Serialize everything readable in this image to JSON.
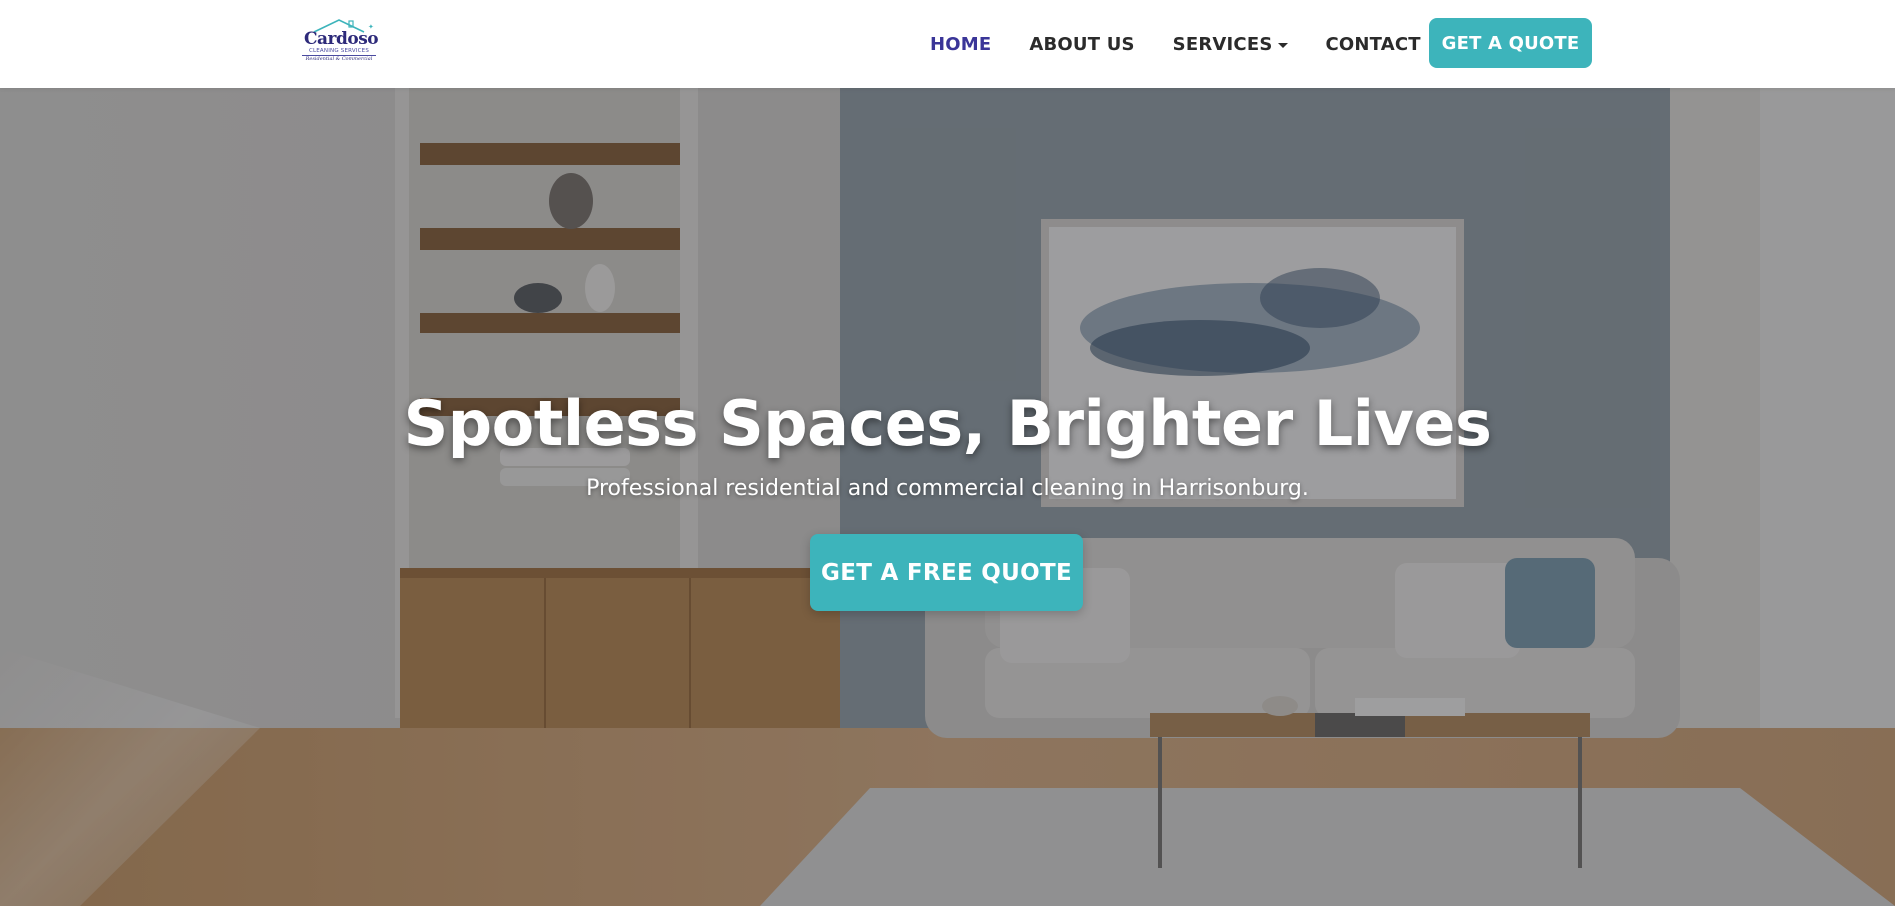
{
  "brand": {
    "name": "Cardoso",
    "subtitle": "CLEANING SERVICES",
    "tagline": "Residential & Commercial",
    "primary_color": "#3a3598",
    "accent_color": "#3db4bb"
  },
  "nav": {
    "items": [
      {
        "label": "HOME",
        "active": true
      },
      {
        "label": "ABOUT US",
        "active": false
      },
      {
        "label": "SERVICES",
        "active": false,
        "dropdown": true
      },
      {
        "label": "CONTACT",
        "active": false
      }
    ],
    "quote_button": "GET A QUOTE"
  },
  "hero": {
    "title": "Spotless Spaces, Brighter Lives",
    "subtitle": "Professional residential and commercial cleaning in Harrisonburg.",
    "cta": "GET A FREE QUOTE"
  }
}
